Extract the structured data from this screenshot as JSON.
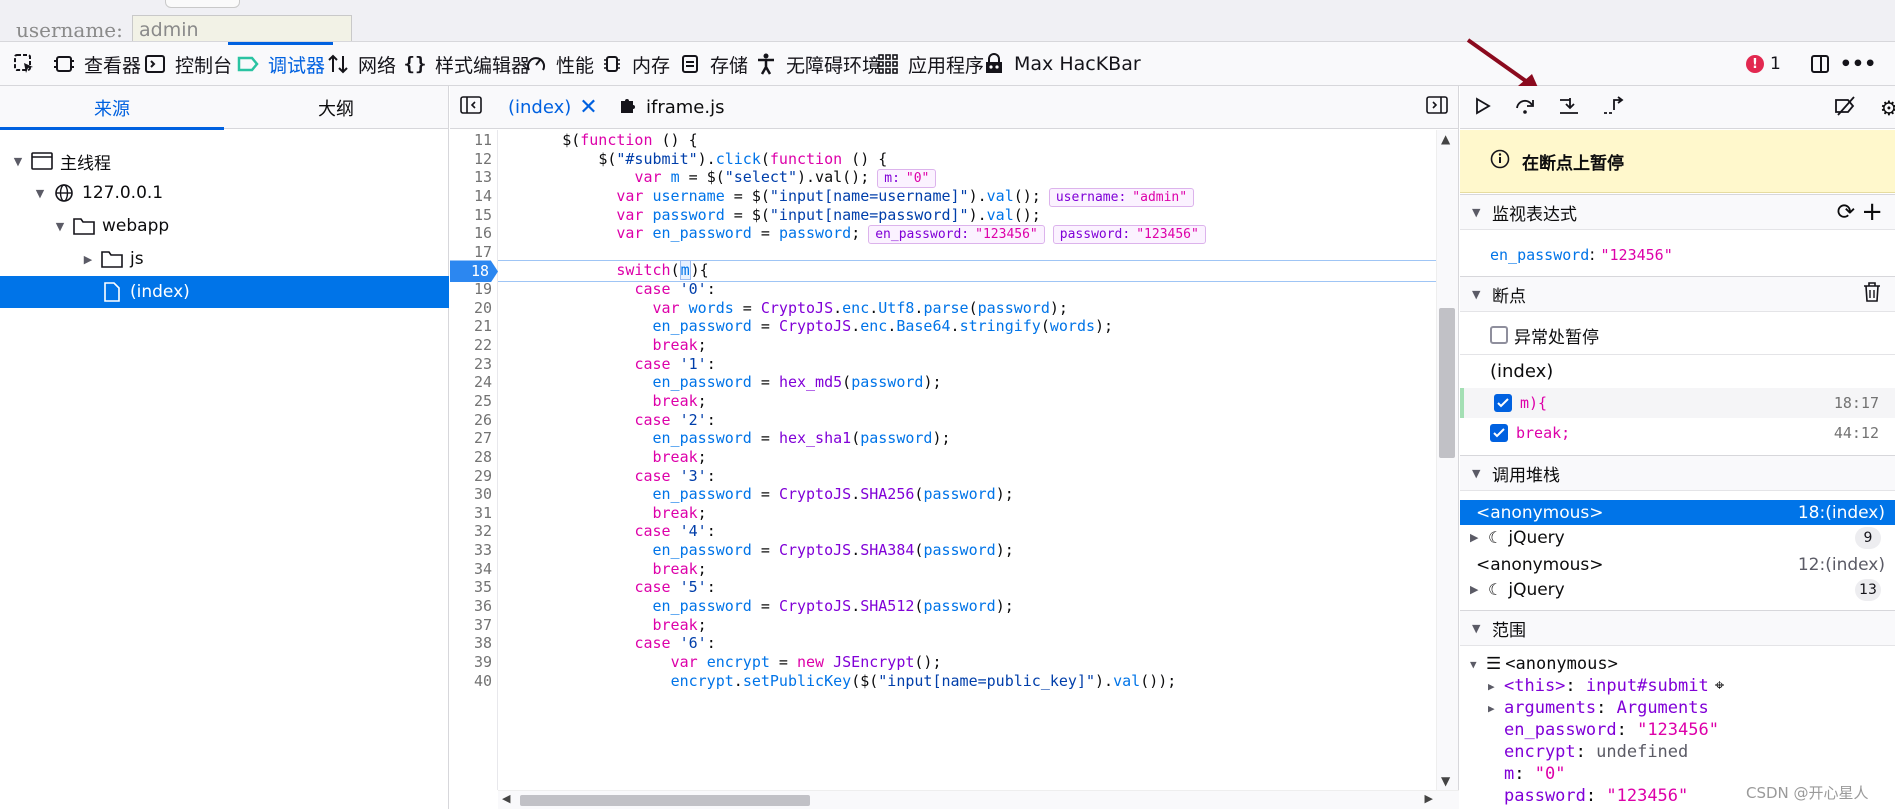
{
  "page": {
    "label": "username:",
    "input_value": "admin"
  },
  "tabs": [
    {
      "label": "查看器",
      "icon": "inspector-icon"
    },
    {
      "label": "控制台",
      "icon": "console-icon"
    },
    {
      "label": "调试器",
      "icon": "debugger-icon",
      "active": true
    },
    {
      "label": "网络",
      "icon": "network-icon"
    },
    {
      "label": "样式编辑器",
      "icon": "style-editor-icon"
    },
    {
      "label": "性能",
      "icon": "performance-icon"
    },
    {
      "label": "内存",
      "icon": "memory-icon"
    },
    {
      "label": "存储",
      "icon": "storage-icon"
    },
    {
      "label": "无障碍环境",
      "icon": "accessibility-icon"
    },
    {
      "label": "应用程序",
      "icon": "application-icon"
    },
    {
      "label": "Max HacKBar",
      "icon": "hackbar-icon"
    }
  ],
  "error_count": "1",
  "sources": {
    "tabs": [
      "来源",
      "大纲"
    ],
    "tree": [
      {
        "label": "主线程",
        "icon": "thread-icon"
      },
      {
        "label": "127.0.0.1",
        "icon": "globe-icon"
      },
      {
        "label": "webapp",
        "icon": "folder-icon"
      },
      {
        "label": "js",
        "icon": "folder-icon"
      },
      {
        "label": "(index)",
        "icon": "file-icon"
      }
    ]
  },
  "editor": {
    "tabs": [
      "(index)",
      "iframe.js"
    ],
    "breakpoint_line": "18",
    "lines": [
      {
        "n": "11",
        "html": "      <span class=\"pl\">$(</span><span class=\"kw\">function</span><span class=\"pl\"> () {</span>"
      },
      {
        "n": "12",
        "html": "          <span class=\"pl\">$(</span><span class=\"str\">\"#submit\"</span><span class=\"pl\">).</span><span class=\"var\">click</span><span class=\"pl\">(</span><span class=\"kw\">function</span><span class=\"pl\"> () {</span>"
      },
      {
        "n": "13",
        "html": "              <span class=\"kw\">var</span> <span class=\"var\">m</span> = <span class=\"pl\">$(</span><span class=\"str\">\"select\"</span><span class=\"pl\">).val();</span><span class=\"preview\">m:<span class=\"pv\">\"0\"</span></span>"
      },
      {
        "n": "14",
        "html": "            <span class=\"kw\">var</span> <span class=\"var\">username</span> = <span class=\"pl\">$(</span><span class=\"str\">\"input[name=username]\"</span><span class=\"pl\">).</span><span class=\"var\">val</span><span class=\"pl\">();</span><span class=\"preview\">username:<span class=\"pv\">\"admin\"</span></span>"
      },
      {
        "n": "15",
        "html": "            <span class=\"kw\">var</span> <span class=\"var\">password</span> = <span class=\"pl\">$(</span><span class=\"str\">\"input[name=password]\"</span><span class=\"pl\">).</span><span class=\"var\">val</span><span class=\"pl\">();</span>"
      },
      {
        "n": "16",
        "html": "            <span class=\"kw\">var</span> <span class=\"var\">en_password</span> = <span class=\"var\">password</span>;<span class=\"preview\">en_password:<span class=\"pv\">\"123456\"</span></span><span class=\"preview\">password:<span class=\"pv\">\"123456\"</span></span>"
      },
      {
        "n": "17",
        "html": ""
      },
      {
        "n": "18",
        "html": "            <span class=\"kw\">switch</span><span class=\"pl\">(</span><span class=\"var sel-m\">m</span><span class=\"pl\">){</span>"
      },
      {
        "n": "19",
        "html": "              <span class=\"kw\">case</span> <span class=\"str\">'0'</span>:"
      },
      {
        "n": "20",
        "html": "                <span class=\"kw\">var</span> <span class=\"var\">words</span> = <span class=\"fn\">CryptoJS</span>.<span class=\"var\">enc</span>.<span class=\"var\">Utf8</span>.<span class=\"var\">parse</span>(<span class=\"var\">password</span>);"
      },
      {
        "n": "21",
        "html": "                <span class=\"var\">en_password</span> = <span class=\"fn\">CryptoJS</span>.<span class=\"var\">enc</span>.<span class=\"var\">Base64</span>.<span class=\"var\">stringify</span>(<span class=\"var\">words</span>);"
      },
      {
        "n": "22",
        "html": "                <span class=\"kw\">break</span>;"
      },
      {
        "n": "23",
        "html": "              <span class=\"kw\">case</span> <span class=\"str\">'1'</span>:"
      },
      {
        "n": "24",
        "html": "                <span class=\"var\">en_password</span> = <span class=\"fn\">hex_md5</span>(<span class=\"var\">password</span>);"
      },
      {
        "n": "25",
        "html": "                <span class=\"kw\">break</span>;"
      },
      {
        "n": "26",
        "html": "              <span class=\"kw\">case</span> <span class=\"str\">'2'</span>:"
      },
      {
        "n": "27",
        "html": "                <span class=\"var\">en_password</span> = <span class=\"fn\">hex_sha1</span>(<span class=\"var\">password</span>);"
      },
      {
        "n": "28",
        "html": "                <span class=\"kw\">break</span>;"
      },
      {
        "n": "29",
        "html": "              <span class=\"kw\">case</span> <span class=\"str\">'3'</span>:"
      },
      {
        "n": "30",
        "html": "                <span class=\"var\">en_password</span> = <span class=\"fn\">CryptoJS</span>.<span class=\"fn\">SHA256</span>(<span class=\"var\">password</span>);"
      },
      {
        "n": "31",
        "html": "                <span class=\"kw\">break</span>;"
      },
      {
        "n": "32",
        "html": "              <span class=\"kw\">case</span> <span class=\"str\">'4'</span>:"
      },
      {
        "n": "33",
        "html": "                <span class=\"var\">en_password</span> = <span class=\"fn\">CryptoJS</span>.<span class=\"fn\">SHA384</span>(<span class=\"var\">password</span>);"
      },
      {
        "n": "34",
        "html": "                <span class=\"kw\">break</span>;"
      },
      {
        "n": "35",
        "html": "              <span class=\"kw\">case</span> <span class=\"str\">'5'</span>:"
      },
      {
        "n": "36",
        "html": "                <span class=\"var\">en_password</span> = <span class=\"fn\">CryptoJS</span>.<span class=\"fn\">SHA512</span>(<span class=\"var\">password</span>);"
      },
      {
        "n": "37",
        "html": "                <span class=\"kw\">break</span>;"
      },
      {
        "n": "38",
        "html": "              <span class=\"kw\">case</span> <span class=\"str\">'6'</span>:"
      },
      {
        "n": "39",
        "html": "                  <span class=\"kw\">var</span> <span class=\"var\">encrypt</span> = <span class=\"kw\">new</span> <span class=\"fn\">JSEncrypt</span>();"
      },
      {
        "n": "40",
        "html": "                  <span class=\"var\">encrypt</span>.<span class=\"var\">setPublicKey</span>($(<span class=\"str\">\"input[name=public_key]\"</span>).<span class=\"var\">val</span>());"
      }
    ]
  },
  "debugger": {
    "paused_label": "在断点上暂停",
    "watch": {
      "title": "监视表达式",
      "items": [
        {
          "name": "en_password",
          "value": "\"123456\""
        }
      ]
    },
    "breakpoints": {
      "title": "断点",
      "pause_exceptions": "异常处暂停",
      "file": "(index)",
      "items": [
        {
          "code": "m){",
          "loc": "18:17"
        },
        {
          "code": "break;",
          "loc": "44:12"
        }
      ]
    },
    "callstack": {
      "title": "调用堆栈",
      "frames": [
        {
          "name": "<anonymous>",
          "loc": "18:(index)",
          "selected": true
        },
        {
          "name": "jQuery",
          "count": "9",
          "group": true
        },
        {
          "name": "<anonymous>",
          "loc": "12:(index)"
        },
        {
          "name": "jQuery",
          "count": "13",
          "group": true
        }
      ]
    },
    "scopes": {
      "title": "范围",
      "block": "<anonymous>",
      "items": [
        {
          "key": "<this>",
          "value": "input#submit"
        },
        {
          "key": "arguments",
          "value": "Arguments"
        },
        {
          "key": "en_password",
          "value": "\"123456\""
        },
        {
          "key": "encrypt",
          "value": "undefined"
        },
        {
          "key": "m",
          "value": "\"0\""
        },
        {
          "key": "password",
          "value": "\"123456\""
        }
      ]
    }
  },
  "watermark": "CSDN @开心星人"
}
